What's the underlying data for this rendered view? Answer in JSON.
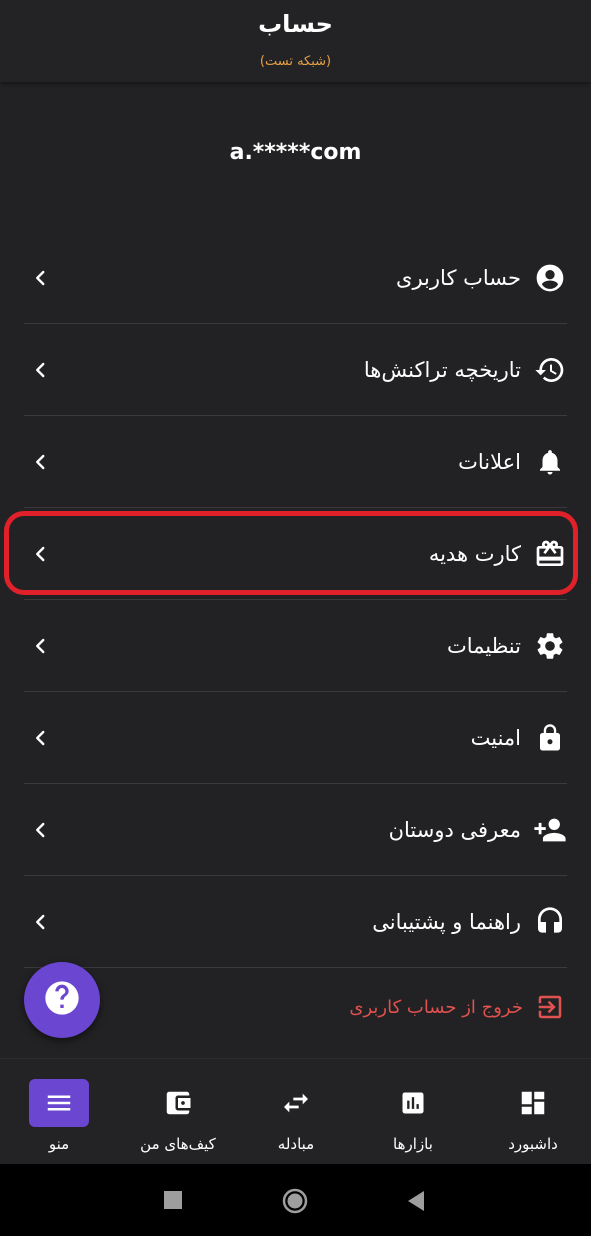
{
  "header": {
    "title": "حساب",
    "subtitle": "(شبکه تست)"
  },
  "account": {
    "email": "a.*****com"
  },
  "menu": {
    "items": [
      {
        "label": "حساب کاربری",
        "icon": "account-circle-icon"
      },
      {
        "label": "تاریخچه تراکنش‌ها",
        "icon": "history-icon"
      },
      {
        "label": "اعلانات",
        "icon": "bell-icon"
      },
      {
        "label": "کارت هدیه",
        "icon": "gift-card-icon",
        "highlighted": true
      },
      {
        "label": "تنظیمات",
        "icon": "gear-icon"
      },
      {
        "label": "امنیت",
        "icon": "lock-icon"
      },
      {
        "label": "معرفی دوستان",
        "icon": "person-add-icon"
      },
      {
        "label": "راهنما و پشتیبانی",
        "icon": "headset-icon"
      }
    ],
    "logout_label": "خروج از حساب کاربری"
  },
  "fab": {
    "icon": "help-icon"
  },
  "bottom_nav": {
    "items": [
      {
        "label": "داشبورد",
        "icon": "dashboard-icon"
      },
      {
        "label": "بازارها",
        "icon": "bar-chart-icon"
      },
      {
        "label": "مبادله",
        "icon": "swap-icon"
      },
      {
        "label": "کیف‌های من",
        "icon": "wallet-icon"
      },
      {
        "label": "منو",
        "icon": "menu-icon",
        "active": true
      }
    ]
  },
  "colors": {
    "background": "#222224",
    "accent": "#6a46d1",
    "highlight": "#e0212a",
    "subtitle": "#e6a043",
    "logout": "#e0514f"
  }
}
